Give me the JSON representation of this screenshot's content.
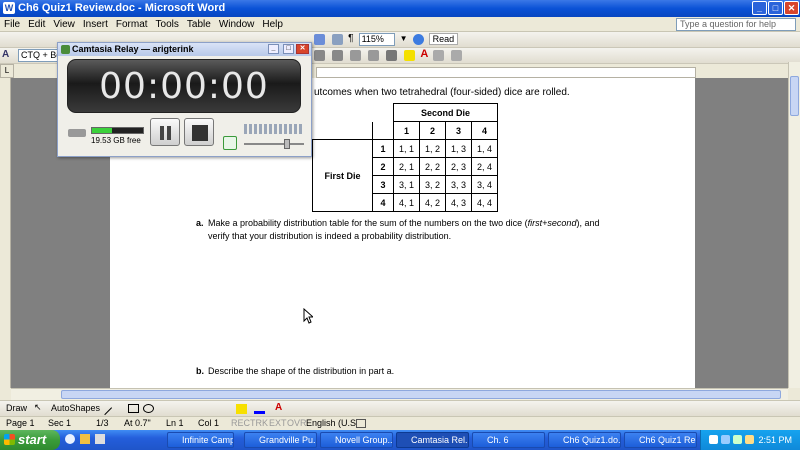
{
  "window": {
    "title": "Ch6 Quiz1 Review.doc - Microsoft Word"
  },
  "menu": {
    "items": [
      "File",
      "Edit",
      "View",
      "Insert",
      "Format",
      "Tools",
      "Table",
      "Window",
      "Help"
    ],
    "ask_placeholder": "Type a question for help"
  },
  "toolbar": {
    "zoom": "115%",
    "read_label": "Read",
    "style_value": "CTQ + Bef"
  },
  "camtasia": {
    "title": "Camtasia Relay — arigterink",
    "timer": "00:00:00",
    "disk_free": "19.53 GB free"
  },
  "document": {
    "intro_text": "utcomes when two tetrahedral (four-sided) dice are rolled.",
    "table": {
      "second_die_label": "Second Die",
      "first_die_label": "First Die",
      "col_headers": [
        "1",
        "2",
        "3",
        "4"
      ],
      "row_headers": [
        "1",
        "2",
        "3",
        "4"
      ],
      "cells": [
        [
          "1, 1",
          "1, 2",
          "1, 3",
          "1, 4"
        ],
        [
          "2, 1",
          "2, 2",
          "2, 3",
          "2, 4"
        ],
        [
          "3, 1",
          "3, 2",
          "3, 3",
          "3, 4"
        ],
        [
          "4, 1",
          "4, 2",
          "4, 3",
          "4, 4"
        ]
      ]
    },
    "part_a_label": "a.",
    "part_a_line1_pre": "Make a probability distribution table for the sum of the numbers on the two dice (",
    "part_a_line1_ital": "first+second",
    "part_a_line1_post": "), and",
    "part_a_line2": "verify that your distribution is indeed a probability distribution.",
    "part_b_label": "b.",
    "part_b_text": "Describe the shape of the distribution in part a."
  },
  "drawbar": {
    "draw_label": "Draw",
    "autoshapes_label": "AutoShapes"
  },
  "status": {
    "page": "Page 1",
    "sec": "Sec 1",
    "pages": "1/3",
    "at": "At 0.7\"",
    "ln": "Ln 1",
    "col": "Col 1",
    "rec": "REC",
    "trk": "TRK",
    "ext": "EXT",
    "ovr": "OVR",
    "lang": "English (U.S"
  },
  "taskbar": {
    "start_label": "start",
    "tasks": [
      "Infinite Camp...",
      "Grandville Pu...",
      "Novell Group...",
      "Camtasia Rel...",
      "Ch. 6",
      "Ch6 Quiz1.do...",
      "Ch6 Quiz1 Re..."
    ],
    "clock": "2:51 PM"
  }
}
